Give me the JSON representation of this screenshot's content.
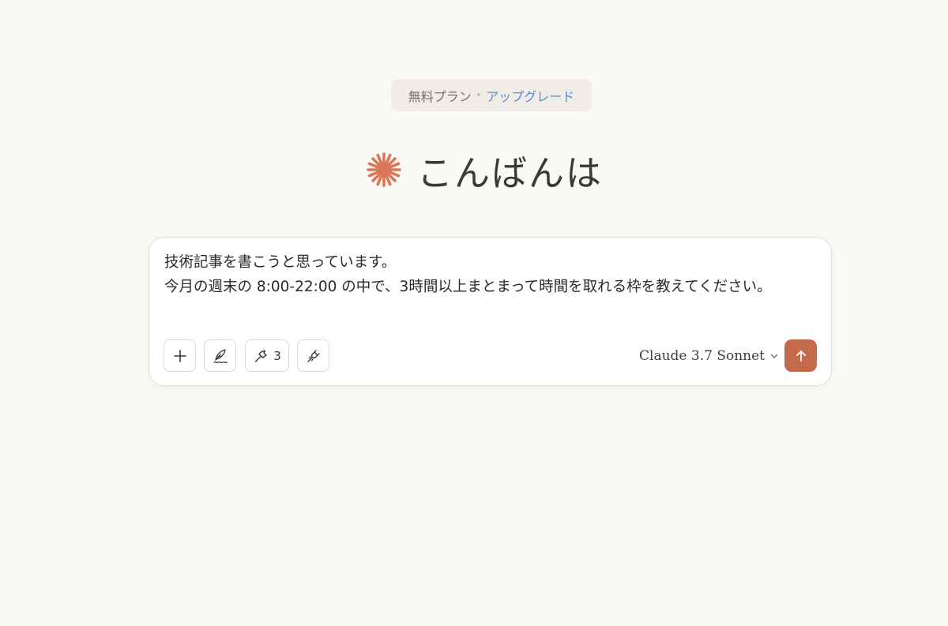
{
  "plan": {
    "name": "無料プラン",
    "separator": "•",
    "upgrade_label": "アップグレード"
  },
  "greeting": {
    "icon": "claude-starburst-icon",
    "text": "こんばんは",
    "accent_color": "#d97757"
  },
  "composer": {
    "message": "技術記事を書こうと思っています。\n今月の週末の 8:00-22:00 の中で、3時間以上まとまって時間を取れる枠を教えてください。",
    "toolbar": {
      "add_icon": "plus-icon",
      "style_icon": "feather-pen-icon",
      "tools_icon": "hammer-icon",
      "tools_count": "3",
      "integrations_icon": "plug-icon"
    },
    "model": {
      "name": "Claude 3.7 Sonnet",
      "dropdown_icon": "chevron-down-icon"
    },
    "send": {
      "icon": "arrow-up-icon",
      "color": "#c56b4c"
    }
  }
}
